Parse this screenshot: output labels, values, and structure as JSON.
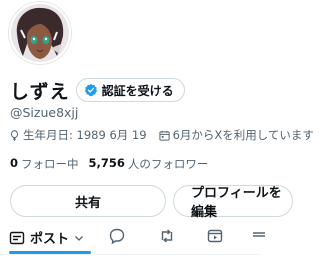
{
  "profile": {
    "display_name": "しずえ",
    "verify_label": "認証を受ける",
    "handle": "@Sizue8xjj",
    "birthday": "生年月日: 1989 6月 19",
    "joined": "6月からXを利用しています",
    "following_count": "0",
    "following_label": "フォロー中",
    "followers_count": "5,756",
    "followers_label": "人のフォロワー"
  },
  "actions": {
    "share_label": "共有",
    "profile_label": "プロフィールを編集"
  },
  "tabs": {
    "posts_label": "ポスト"
  },
  "colors": {
    "accent": "#1d9bf0",
    "secondary_text": "#536471",
    "border": "#cfd9de"
  },
  "icons": [
    "verified-badge-icon",
    "balloon-icon",
    "calendar-icon",
    "chevron-down-icon",
    "reply-icon",
    "retweet-icon",
    "media-icon",
    "tab-feed-icon"
  ]
}
